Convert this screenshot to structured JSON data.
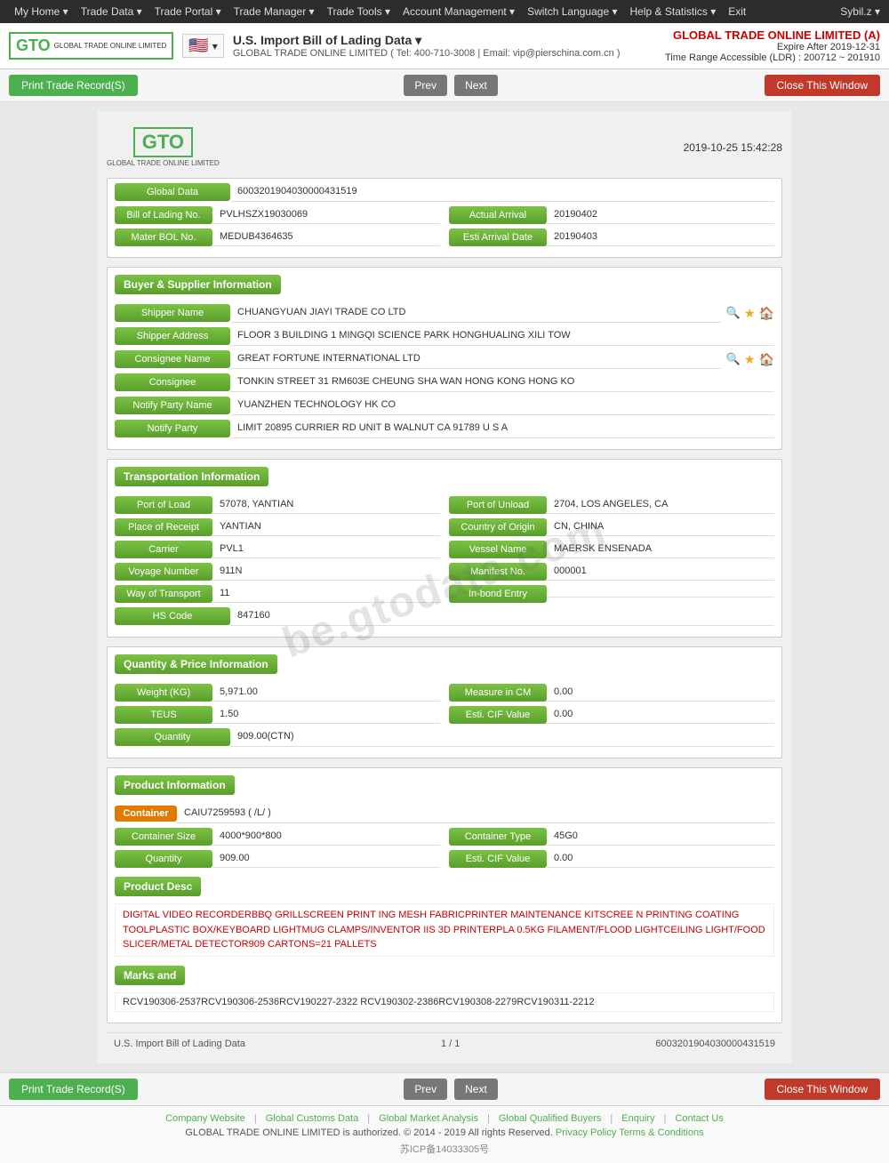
{
  "topnav": {
    "items": [
      "My Home ▾",
      "Trade Data ▾",
      "Trade Portal ▾",
      "Trade Manager ▾",
      "Trade Tools ▾",
      "Account Management ▾",
      "Switch Language ▾",
      "Help & Statistics ▾",
      "Exit"
    ],
    "user": "Sybil.z ▾"
  },
  "header": {
    "logo_gto": "GTO",
    "logo_sub": "GLOBAL TRADE ONLINE LIMITED",
    "flag_emoji": "🇺🇸",
    "title": "U.S. Import Bill of Lading Data ▾",
    "contact": "GLOBAL TRADE ONLINE LIMITED ( Tel: 400-710-3008 | Email: vip@pierschina.com.cn )",
    "company": "GLOBAL TRADE ONLINE LIMITED (A)",
    "expire": "Expire After 2019-12-31",
    "range": "Time Range Accessible (LDR) : 200712 ~ 201910"
  },
  "toolbar": {
    "print_label": "Print Trade Record(S)",
    "prev_label": "Prev",
    "next_label": "Next",
    "close_label": "Close This Window"
  },
  "document": {
    "timestamp": "2019-10-25 15:42:28",
    "global_data_label": "Global Data",
    "global_data_value": "6003201904030000431519",
    "bol_label": "Bill of Lading No.",
    "bol_value": "PVLHSZX19030069",
    "actual_arrival_label": "Actual Arrival",
    "actual_arrival_value": "20190402",
    "mater_bol_label": "Mater BOL No.",
    "mater_bol_value": "MEDUB4364635",
    "esti_arrival_label": "Esti Arrival Date",
    "esti_arrival_value": "20190403"
  },
  "buyer_supplier": {
    "section_title": "Buyer & Supplier Information",
    "shipper_name_label": "Shipper Name",
    "shipper_name_value": "CHUANGYUAN JIAYI TRADE CO LTD",
    "shipper_address_label": "Shipper Address",
    "shipper_address_value": "FLOOR 3 BUILDING 1 MINGQI SCIENCE PARK HONGHUALING XILI TOW",
    "consignee_name_label": "Consignee Name",
    "consignee_name_value": "GREAT FORTUNE INTERNATIONAL LTD",
    "consignee_label": "Consignee",
    "consignee_value": "TONKIN STREET 31 RM603E CHEUNG SHA WAN HONG KONG HONG KO",
    "notify_party_name_label": "Notify Party Name",
    "notify_party_name_value": "YUANZHEN TECHNOLOGY HK CO",
    "notify_party_label": "Notify Party",
    "notify_party_value": "LIMIT 20895 CURRIER RD UNIT B WALNUT CA 91789 U S A"
  },
  "transportation": {
    "section_title": "Transportation Information",
    "port_of_load_label": "Port of Load",
    "port_of_load_value": "57078, YANTIAN",
    "port_of_unload_label": "Port of Unload",
    "port_of_unload_value": "2704, LOS ANGELES, CA",
    "place_of_receipt_label": "Place of Receipt",
    "place_of_receipt_value": "YANTIAN",
    "country_of_origin_label": "Country of Origin",
    "country_of_origin_value": "CN, CHINA",
    "carrier_label": "Carrier",
    "carrier_value": "PVL1",
    "vessel_name_label": "Vessel Name",
    "vessel_name_value": "MAERSK ENSENADA",
    "voyage_number_label": "Voyage Number",
    "voyage_number_value": "911N",
    "manifest_no_label": "Manifest No.",
    "manifest_no_value": "000001",
    "way_of_transport_label": "Way of Transport",
    "way_of_transport_value": "11",
    "in_bond_entry_label": "In-bond Entry",
    "in_bond_entry_value": "",
    "hs_code_label": "HS Code",
    "hs_code_value": "847160"
  },
  "quantity_price": {
    "section_title": "Quantity & Price Information",
    "weight_label": "Weight (KG)",
    "weight_value": "5,971.00",
    "measure_cm_label": "Measure in CM",
    "measure_cm_value": "0.00",
    "teus_label": "TEUS",
    "teus_value": "1.50",
    "esti_cif_label": "Esti. CIF Value",
    "esti_cif_value": "0.00",
    "quantity_label": "Quantity",
    "quantity_value": "909.00(CTN)"
  },
  "product_info": {
    "section_title": "Product Information",
    "container_label": "Container",
    "container_value": "CAIU7259593",
    "container_size_label": "Container Size",
    "container_type_label": "Container Type",
    "container_size_value": "4000*900*800",
    "container_type_value": "45G0",
    "quantity_label": "Quantity",
    "quantity_value": "909.00",
    "esti_cif_label": "Esti. CIF Value",
    "esti_cif_value": "0.00",
    "container_extra": "( /L/ )",
    "product_desc_title": "Product Desc",
    "product_desc_value": "DIGITAL VIDEO RECORDERBBQ GRILLSCREEN PRINT ING MESH FABRICPRINTER MAINTENANCE KITSCREE N PRINTING COATING TOOLPLASTIC BOX/KEYBOARD LIGHTMUG CLAMPS/INVENTOR IIS 3D PRINTERPLA 0.5KG FILAMENT/FLOOD LIGHTCEILING LIGHT/FOOD SLICER/METAL DETECTOR909 CARTONS=21 PALLETS",
    "marks_title": "Marks and",
    "marks_value": "RCV190306-2537RCV190306-2536RCV190227-2322 RCV190302-2386RCV190308-2279RCV190311-2212"
  },
  "doc_footer": {
    "left": "U.S. Import Bill of Lading Data",
    "page": "1 / 1",
    "right": "6003201904030000431519"
  },
  "site_footer": {
    "icp": "苏ICP备14033305号",
    "links": [
      "Company Website",
      "Global Customs Data",
      "Global Market Analysis",
      "Global Qualified Buyers",
      "Enquiry",
      "Contact Us"
    ],
    "copyright": "GLOBAL TRADE ONLINE LIMITED is authorized. © 2014 - 2019 All rights Reserved.",
    "privacy": "Privacy Policy",
    "terms": "Terms & Conditions",
    "watermark": "be.gtodata.com"
  }
}
